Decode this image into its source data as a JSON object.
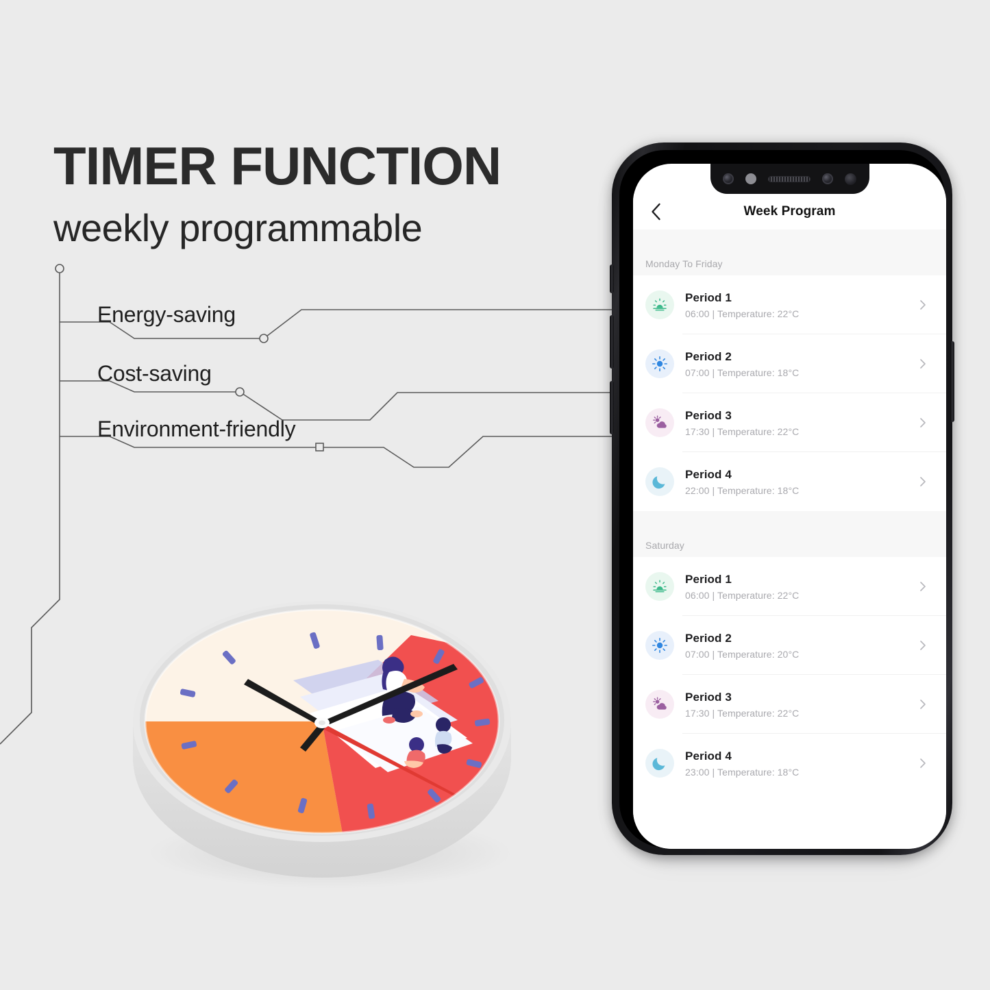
{
  "background_color": "#ebebeb",
  "headline": {
    "title": "TIMER FUNCTION",
    "subtitle": "weekly programmable"
  },
  "features": [
    {
      "label": "Energy-saving"
    },
    {
      "label": "Cost-saving"
    },
    {
      "label": "Environment-friendly"
    }
  ],
  "phone": {
    "navbar": {
      "back_icon": "chevron-left-icon",
      "title": "Week Program"
    },
    "sections": [
      {
        "header": "Monday To Friday",
        "rows": [
          {
            "icon": "sunrise-icon",
            "icon_style": "ic-sunrise",
            "title": "Period 1",
            "subtitle": "06:00  |  Temperature: 22°C",
            "time": "06:00",
            "temperature": "22°C",
            "chevron": "chevron-right-icon"
          },
          {
            "icon": "sun-icon",
            "icon_style": "ic-sun",
            "title": "Period 2",
            "subtitle": "07:00  |  Temperature: 18°C",
            "time": "07:00",
            "temperature": "18°C",
            "chevron": "chevron-right-icon"
          },
          {
            "icon": "sun-cloud-icon",
            "icon_style": "ic-cloud",
            "title": "Period 3",
            "subtitle": "17:30  |  Temperature: 22°C",
            "time": "17:30",
            "temperature": "22°C",
            "chevron": "chevron-right-icon"
          },
          {
            "icon": "moon-icon",
            "icon_style": "ic-moon",
            "title": "Period 4",
            "subtitle": "22:00  |  Temperature: 18°C",
            "time": "22:00",
            "temperature": "18°C",
            "chevron": "chevron-right-icon"
          }
        ]
      },
      {
        "header": "Saturday",
        "rows": [
          {
            "icon": "sunrise-icon",
            "icon_style": "ic-sunrise",
            "title": "Period 1",
            "subtitle": "06:00  |  Temperature: 22°C",
            "time": "06:00",
            "temperature": "22°C",
            "chevron": "chevron-right-icon"
          },
          {
            "icon": "sun-icon",
            "icon_style": "ic-sun",
            "title": "Period 2",
            "subtitle": "07:00  |  Temperature: 20°C",
            "time": "07:00",
            "temperature": "20°C",
            "chevron": "chevron-right-icon"
          },
          {
            "icon": "sun-cloud-icon",
            "icon_style": "ic-cloud",
            "title": "Period 3",
            "subtitle": "17:30  |  Temperature: 22°C",
            "time": "17:30",
            "temperature": "22°C",
            "chevron": "chevron-right-icon"
          },
          {
            "icon": "moon-icon",
            "icon_style": "ic-moon",
            "title": "Period 4",
            "subtitle": "23:00  |  Temperature: 18°C",
            "time": "23:00",
            "temperature": "18°C",
            "chevron": "chevron-right-icon"
          }
        ]
      }
    ],
    "hardware": {
      "notch_items": [
        "front-camera-icon",
        "light-sensor-icon",
        "earpiece-speaker-icon",
        "proximity-sensor-icon",
        "face-id-sensor-icon"
      ],
      "buttons": [
        "mute-switch",
        "volume-up-button",
        "volume-down-button",
        "power-button"
      ]
    }
  },
  "icon_colors": {
    "sunrise": "#3cb98a",
    "sun": "#2f86e0",
    "sun_cloud": "#9b5fa0",
    "moon": "#5bb8d8",
    "chevron": "#b8b8bd"
  },
  "clock": {
    "name": "wall-clock-illustration",
    "sectors": [
      {
        "name": "cream-sector",
        "color": "#fdf3e7"
      },
      {
        "name": "orange-sector",
        "color": "#f98f42"
      },
      {
        "name": "red-sector",
        "color": "#f1504f"
      }
    ],
    "tick_color": "#6b6fc4",
    "case_color": "#e9e9e9",
    "hour_hand_color": "#1c1c1c",
    "minute_hand_color": "#1c1c1c",
    "second_hand_color": "#e03a33",
    "illustration": "family-on-mat-illustration"
  },
  "circuit": {
    "line_color": "#5a5a5a",
    "node_shapes": [
      "circle",
      "circle",
      "circle",
      "square"
    ]
  }
}
